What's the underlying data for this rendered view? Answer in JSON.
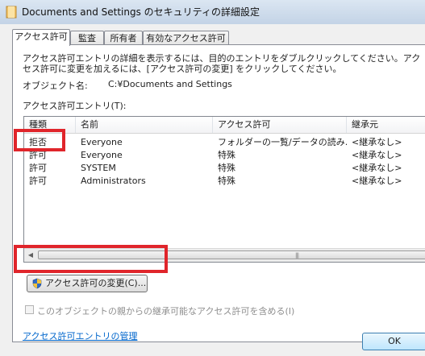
{
  "window": {
    "title": "Documents and Settings のセキュリティの詳細設定"
  },
  "tabs": [
    {
      "label": "アクセス許可",
      "active": true
    },
    {
      "label": "監査",
      "active": false
    },
    {
      "label": "所有者",
      "active": false
    },
    {
      "label": "有効なアクセス許可",
      "active": false
    }
  ],
  "panel": {
    "description": "アクセス許可エントリの詳細を表示するには、目的のエントリをダブルクリックしてください。アクセス許可に変更を加えるには、[アクセス許可の変更] をクリックしてください。",
    "object_label": "オブジェクト名:",
    "object_value": "C:¥Documents and Settings",
    "entries_label": "アクセス許可エントリ(T):"
  },
  "list": {
    "columns": [
      "種類",
      "名前",
      "アクセス許可",
      "継承元"
    ],
    "rows": [
      [
        "拒否",
        "Everyone",
        "フォルダーの一覧/データの読み...",
        "<継承なし>"
      ],
      [
        "許可",
        "Everyone",
        "特殊",
        "<継承なし>"
      ],
      [
        "許可",
        "SYSTEM",
        "特殊",
        "<継承なし>"
      ],
      [
        "許可",
        "Administrators",
        "特殊",
        "<継承なし>"
      ]
    ]
  },
  "buttons": {
    "change": "アクセス許可の変更(C)...",
    "ok": "OK"
  },
  "inherit_checkbox": {
    "label": "このオブジェクトの親からの継承可能なアクセス許可を含める(I)",
    "checked": false,
    "enabled": false
  },
  "manage_link": "アクセス許可エントリの管理",
  "colors": {
    "highlight": "#e0252b",
    "link": "#0066cc"
  }
}
